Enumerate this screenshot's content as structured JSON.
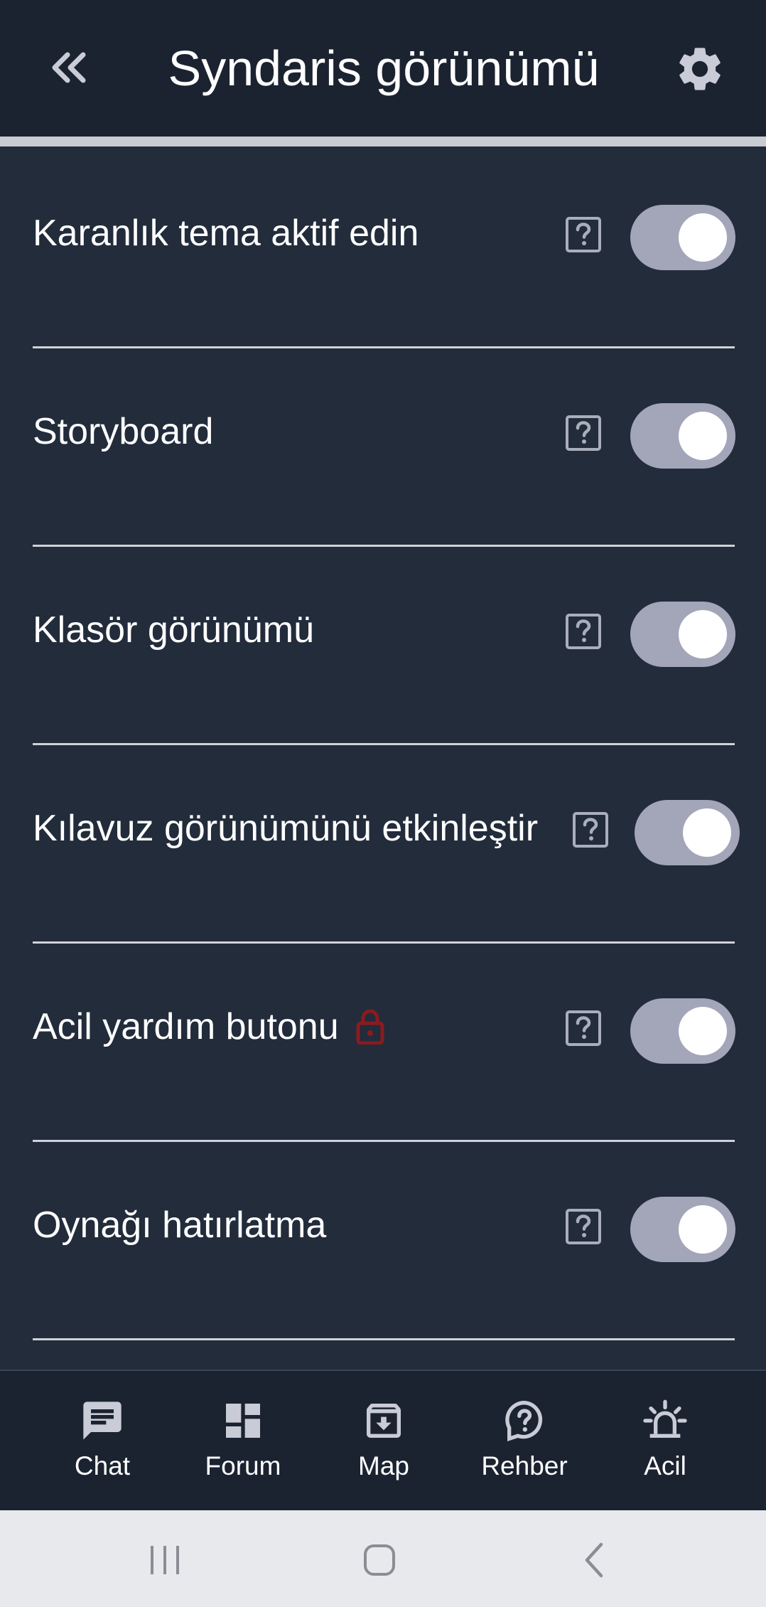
{
  "header": {
    "title": "Syndaris görünümü"
  },
  "settings": [
    {
      "label": "Karanlık tema aktif edin",
      "enabled": true,
      "locked": false
    },
    {
      "label": "Storyboard",
      "enabled": true,
      "locked": false
    },
    {
      "label": "Klasör görünümü",
      "enabled": true,
      "locked": false
    },
    {
      "label": "Kılavuz görünümünü etkinleştir",
      "enabled": true,
      "locked": false
    },
    {
      "label": "Acil yardım butonu",
      "enabled": true,
      "locked": true
    },
    {
      "label": "Oynağı hatırlatma",
      "enabled": true,
      "locked": false
    }
  ],
  "nav": {
    "items": [
      {
        "label": "Chat",
        "icon": "chat-icon"
      },
      {
        "label": "Forum",
        "icon": "dashboard-icon"
      },
      {
        "label": "Map",
        "icon": "archive-download-icon"
      },
      {
        "label": "Rehber",
        "icon": "help-bubble-icon"
      },
      {
        "label": "Acil",
        "icon": "siren-icon"
      }
    ]
  },
  "colors": {
    "header_bg": "#1b2331",
    "content_bg": "#222c3b",
    "toggle_track": "#a3a5b9",
    "lock": "#8b1a1f",
    "help_icon": "#a9aebb"
  }
}
